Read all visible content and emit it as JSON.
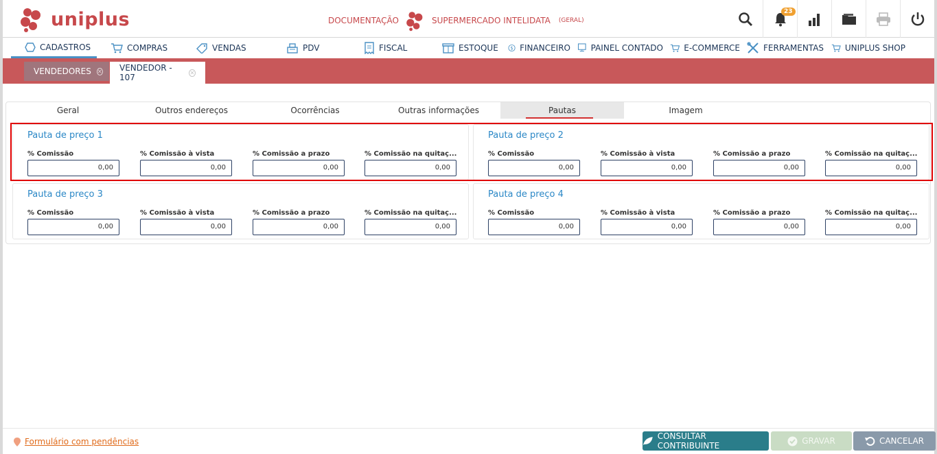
{
  "app": {
    "logo_text": "uniplus"
  },
  "header": {
    "documentation": "DOCUMENTAÇÃO",
    "company": "SUPERMERCADO INTELIDATA",
    "company_scope": "(GERAL)",
    "notification_count": "23"
  },
  "menu": [
    {
      "label": "CADASTROS",
      "icon": "hexagon-icon"
    },
    {
      "label": "COMPRAS",
      "icon": "cart-icon"
    },
    {
      "label": "VENDAS",
      "icon": "tag-icon"
    },
    {
      "label": "PDV",
      "icon": "cash-register-icon"
    },
    {
      "label": "FISCAL",
      "icon": "receipt-icon"
    },
    {
      "label": "ESTOQUE",
      "icon": "box-icon"
    },
    {
      "label": "FINANCEIRO",
      "icon": "dollar-icon"
    },
    {
      "label": "PAINEL CONTADO",
      "icon": "monitor-icon"
    },
    {
      "label": "E-COMMERCE",
      "icon": "cart-icon"
    },
    {
      "label": "FERRAMENTAS",
      "icon": "tools-icon"
    },
    {
      "label": "UNIPLUS SHOP",
      "icon": "cart-icon"
    }
  ],
  "window_tabs": [
    {
      "label": "VENDEDORES"
    },
    {
      "label": "VENDEDOR - 107"
    }
  ],
  "subtabs": [
    "Geral",
    "Outros endereços",
    "Ocorrências",
    "Outras informações",
    "Pautas",
    "Imagem"
  ],
  "fields": [
    "% Comissão",
    "% Comissão à vista",
    "% Comissão a prazo",
    "% Comissão na quitaç..."
  ],
  "pautas": [
    {
      "title": "Pauta de preço 1",
      "values": [
        "0,00",
        "0,00",
        "0,00",
        "0,00"
      ]
    },
    {
      "title": "Pauta de preço 2",
      "values": [
        "0,00",
        "0,00",
        "0,00",
        "0,00"
      ]
    },
    {
      "title": "Pauta de preço 3",
      "values": [
        "0,00",
        "0,00",
        "0,00",
        "0,00"
      ]
    },
    {
      "title": "Pauta de preço 4",
      "values": [
        "0,00",
        "0,00",
        "0,00",
        "0,00"
      ]
    }
  ],
  "footer": {
    "pending": "Formulário com pendências",
    "consult": "CONSULTAR CONTRIBUINTE",
    "save": "GRAVAR",
    "cancel": "CANCELAR"
  }
}
